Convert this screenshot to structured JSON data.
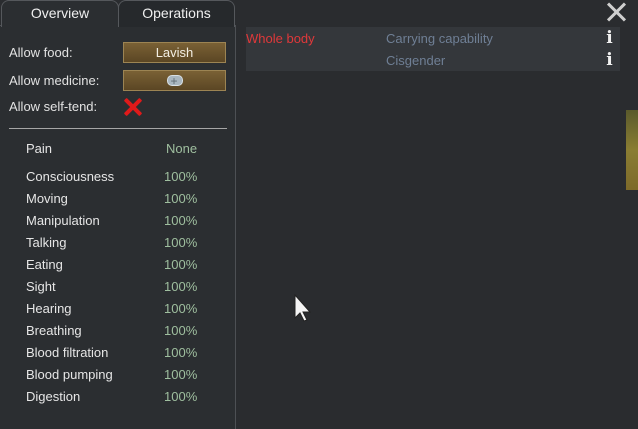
{
  "tabs": [
    "Overview",
    "Operations"
  ],
  "settings": {
    "allow_food_label": "Allow food:",
    "allow_food_value": "Lavish",
    "allow_medicine_label": "Allow medicine:",
    "allow_medicine_icon": "medicine-icon",
    "allow_self_tend_label": "Allow self-tend:",
    "allow_self_tend_icon": "red-x-icon"
  },
  "capacities": [
    {
      "name": "Pain",
      "value": "None"
    },
    {
      "name": "Consciousness",
      "value": "100%"
    },
    {
      "name": "Moving",
      "value": "100%"
    },
    {
      "name": "Manipulation",
      "value": "100%"
    },
    {
      "name": "Talking",
      "value": "100%"
    },
    {
      "name": "Eating",
      "value": "100%"
    },
    {
      "name": "Sight",
      "value": "100%"
    },
    {
      "name": "Hearing",
      "value": "100%"
    },
    {
      "name": "Breathing",
      "value": "100%"
    },
    {
      "name": "Blood filtration",
      "value": "100%"
    },
    {
      "name": "Blood pumping",
      "value": "100%"
    },
    {
      "name": "Digestion",
      "value": "100%"
    }
  ],
  "health": {
    "body_part": "Whole body",
    "hediffs": [
      "Carrying capability",
      "Cisgender"
    ]
  },
  "colors": {
    "body_part": "#e0383a",
    "hediff": "#6f7f95",
    "capacity_value": "#9fbf9f"
  }
}
